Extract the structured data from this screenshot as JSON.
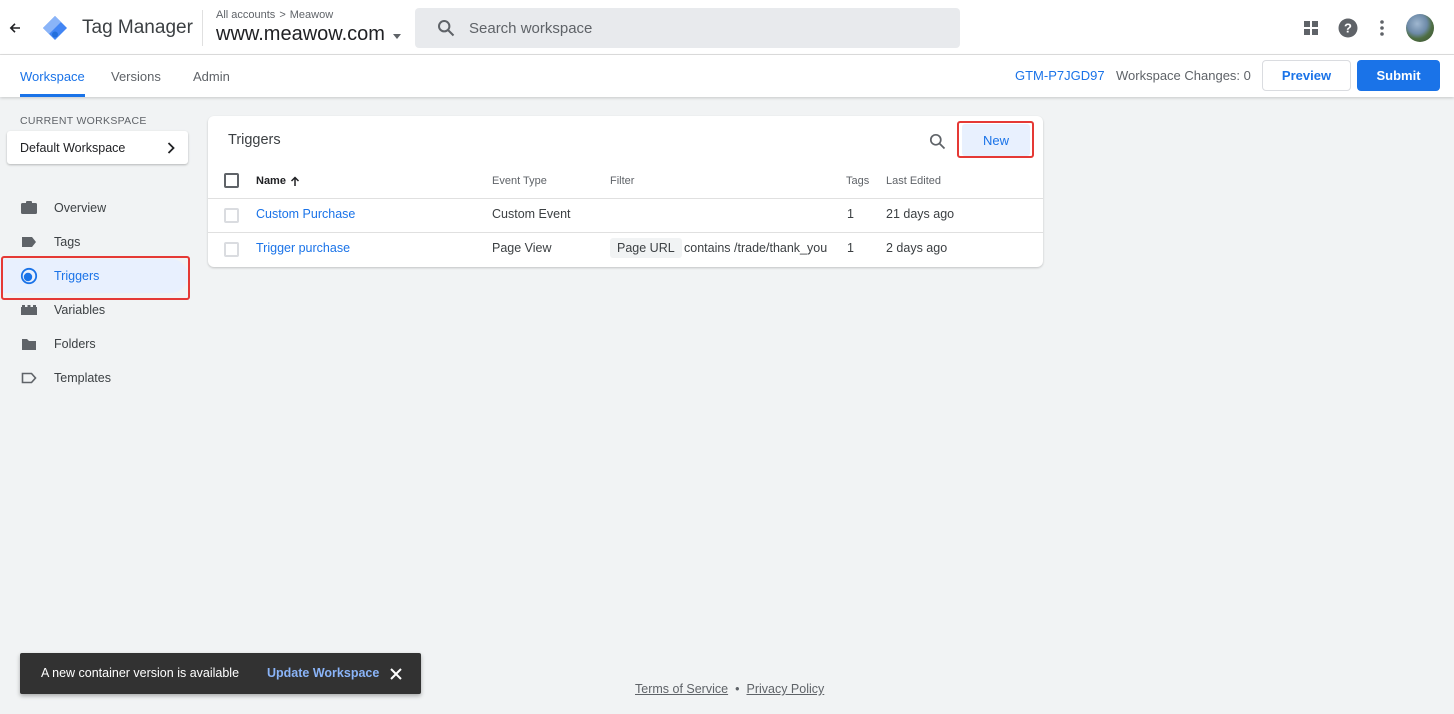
{
  "app": {
    "product_name": "Tag Manager",
    "breadcrumb": {
      "account": "All accounts",
      "separator": ">",
      "container_account": "Meawow"
    },
    "container_name": "www.meawow.com",
    "search_placeholder": "Search workspace"
  },
  "tabs": [
    {
      "label": "Workspace",
      "active": true
    },
    {
      "label": "Versions",
      "active": false
    },
    {
      "label": "Admin",
      "active": false
    }
  ],
  "header_right": {
    "container_id": "GTM-P7JGD97",
    "workspace_changes": "Workspace Changes: 0",
    "preview_label": "Preview",
    "submit_label": "Submit"
  },
  "sidebar": {
    "current_workspace_label": "CURRENT WORKSPACE",
    "workspace_name": "Default Workspace",
    "items": [
      {
        "label": "Overview",
        "icon": "briefcase-icon",
        "active": false
      },
      {
        "label": "Tags",
        "icon": "tag-icon",
        "active": false
      },
      {
        "label": "Triggers",
        "icon": "trigger-icon",
        "active": true
      },
      {
        "label": "Variables",
        "icon": "variables-icon",
        "active": false
      },
      {
        "label": "Folders",
        "icon": "folder-icon",
        "active": false
      },
      {
        "label": "Templates",
        "icon": "template-icon",
        "active": false
      }
    ]
  },
  "triggers": {
    "title": "Triggers",
    "new_label": "New",
    "columns": [
      "Name",
      "Event Type",
      "Filter",
      "Tags",
      "Last Edited"
    ],
    "rows": [
      {
        "name": "Custom Purchase",
        "event_type": "Custom Event",
        "filter_chip": "",
        "filter_text": "",
        "tags": "1",
        "last_edited": "21 days ago"
      },
      {
        "name": "Trigger purchase",
        "event_type": "Page View",
        "filter_chip": "Page URL",
        "filter_text": "contains /trade/thank_you",
        "tags": "1",
        "last_edited": "2 days ago"
      }
    ]
  },
  "toast": {
    "message": "A new container version is available",
    "action": "Update Workspace"
  },
  "footer": {
    "terms": "Terms of Service",
    "separator": "•",
    "privacy": "Privacy Policy"
  },
  "colors": {
    "accent": "#1a73e8",
    "highlight_box": "#e53935",
    "active_nav_bg": "#e8f0fe"
  }
}
